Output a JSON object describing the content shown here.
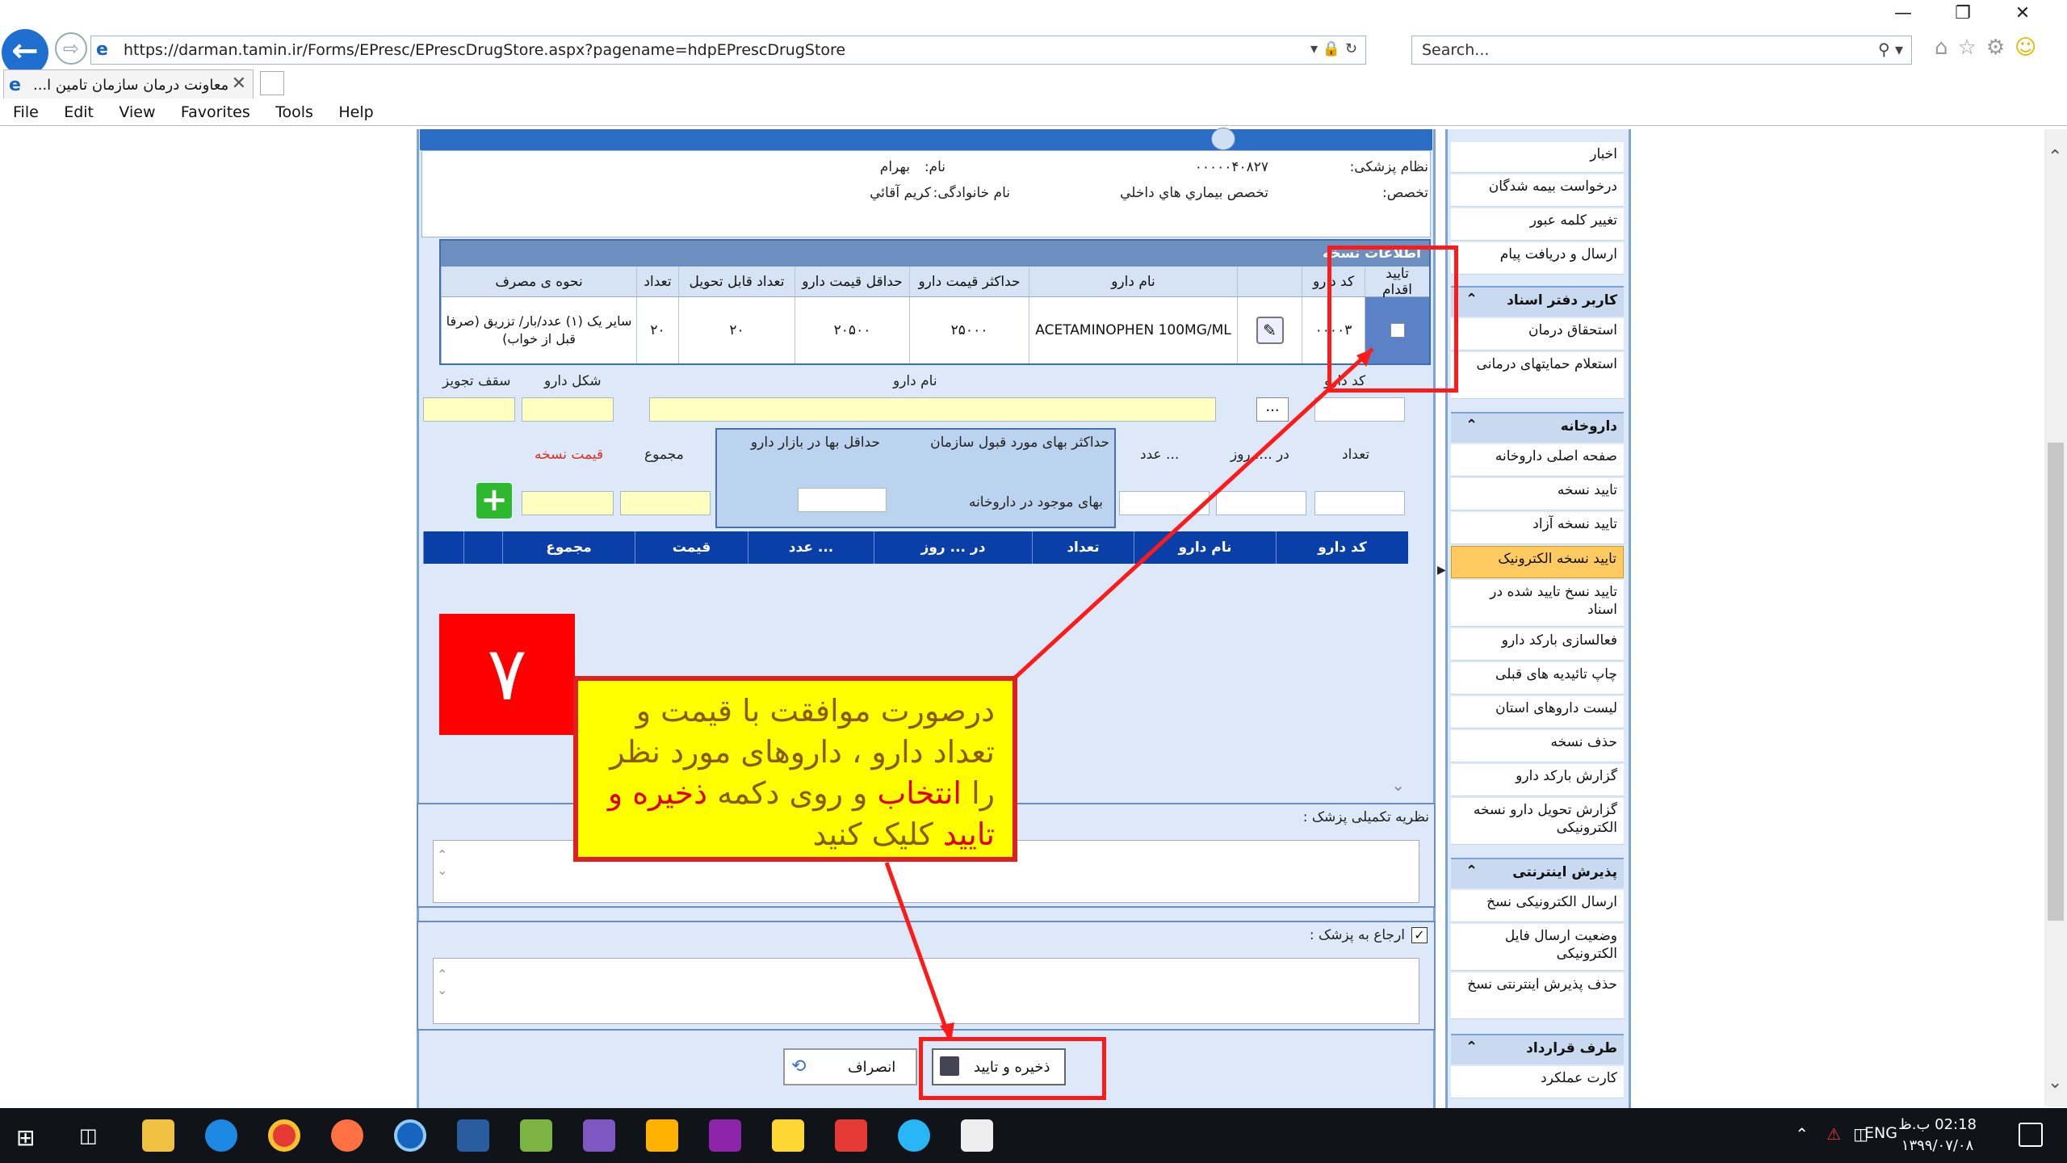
{
  "browser": {
    "url": "https://darman.tamin.ir/Forms/EPresc/EPrescDrugStore.aspx?pagename=hdpEPrescDrugStore",
    "search_placeholder": "Search...",
    "tab_title": "معاونت درمان سازمان تامين ا...",
    "menu": [
      "File",
      "Edit",
      "View",
      "Favorites",
      "Tools",
      "Help"
    ]
  },
  "doctor": {
    "code_label": "نظام پزشکی:",
    "code_value": "۰۰۰۰۰۴۰۸۲۷",
    "name_label": "نام:",
    "name_value": "بهرام",
    "specialty_label": "تخصص:",
    "specialty_value": "تخصص بيماري هاي داخلي",
    "family_label": "نام خانوادگی:",
    "family_value": "کريم آقائي"
  },
  "prescription": {
    "title": "اطلاعات نسخه",
    "columns": [
      "تایید اقدام",
      "کد دارو",
      "نام دارو",
      "حداکثر قیمت دارو",
      "حداقل قیمت دارو",
      "تعداد قابل تحویل",
      "تعداد",
      "نحوه ی مصرف"
    ],
    "row": {
      "code": "۰۰۰۰۳",
      "name": "ACETAMINOPHEN 100MG/ML",
      "max_price": "۲۵۰۰۰",
      "min_price": "۲۰۵۰۰",
      "deliverable": "۲۰",
      "count": "۲۰",
      "usage": "سایر یک (۱) عدد/بار/ تزریق (صرفا قبل از خواب)"
    }
  },
  "form": {
    "drug_code": "کد دارو",
    "drug_name": "نام دارو",
    "drug_form": "شکل دارو",
    "max_prescribe": "سقف تجویز",
    "count": "تعداد",
    "per_day": "در .... روز",
    "per_unit": "... عدد",
    "max_price": "حداکثر بهای مورد قبول سازمان",
    "min_price": "حداقل بها در بازار دارو",
    "pharmacy_price": "بهای موجود در داروخانه",
    "total": "مجموع",
    "presc_price": "قیمت نسخه",
    "browse": "..."
  },
  "grid": {
    "columns": [
      "کد دارو",
      "نام دارو",
      "تعداد",
      "در ... روز",
      "... عدد",
      "قیمت",
      "مجموع",
      "",
      ""
    ]
  },
  "comments": {
    "doctor_comment": "نظریه تکمیلی پزشک :",
    "refer_label": "ارجاع به پزشک :"
  },
  "buttons": {
    "save": "ذخیره و تایید",
    "cancel": "انصراف"
  },
  "sidebar": {
    "top_items": [
      "اخبار",
      "درخواست بیمه شدگان",
      "تغییر کلمه عبور",
      "ارسال و دریافت پیام"
    ],
    "sections": [
      {
        "title": "کاربر دفتر اسناد",
        "items": [
          "استحقاق درمان",
          "استعلام حمایتهای درمانی"
        ]
      },
      {
        "title": "داروخانه",
        "items": [
          "صفحه اصلی داروخانه",
          "تایید نسخه",
          "تایید نسخه آزاد",
          "تایید نسخه الکترونیک",
          "تایید نسخ تایید شده در اسناد",
          "فعالسازی بارکد دارو",
          "چاپ تائیدیه های قبلی",
          "لیست داروهای استان",
          "حذف نسخه",
          "گزارش بارکد دارو",
          "گزارش تحویل دارو نسخه الکترونیکی"
        ]
      },
      {
        "title": "پذیرش اینترنتی",
        "items": [
          "ارسال الکترونیکی نسخ",
          "وضعیت ارسال فایل الکترونیکی",
          "حذف پذیرش اینترنتی نسخ"
        ]
      },
      {
        "title": "طرف قرارداد",
        "items": [
          "کارت عملکرد"
        ]
      }
    ],
    "active_item": "تایید نسخه الکترونیک"
  },
  "annotation": {
    "step": "۷",
    "text_part1": "درصورت موافقت با قیمت و تعداد دارو ، داروهای مورد نظر را",
    "text_hl1": "انتخاب",
    "text_part2": "و روی دکمه",
    "text_hl2": "ذخیره و تایید",
    "text_part3": "کلیک کنید"
  },
  "taskbar": {
    "lang": "ENG",
    "time": "02:18 ب.ظ",
    "date": "۱۳۹۹/۰۷/۰۸"
  },
  "colors": {
    "accent_blue": "#0a3fa8",
    "annotation_red": "#ff0000",
    "annotation_yellow": "#ffff00",
    "active_item": "#ffca60"
  }
}
